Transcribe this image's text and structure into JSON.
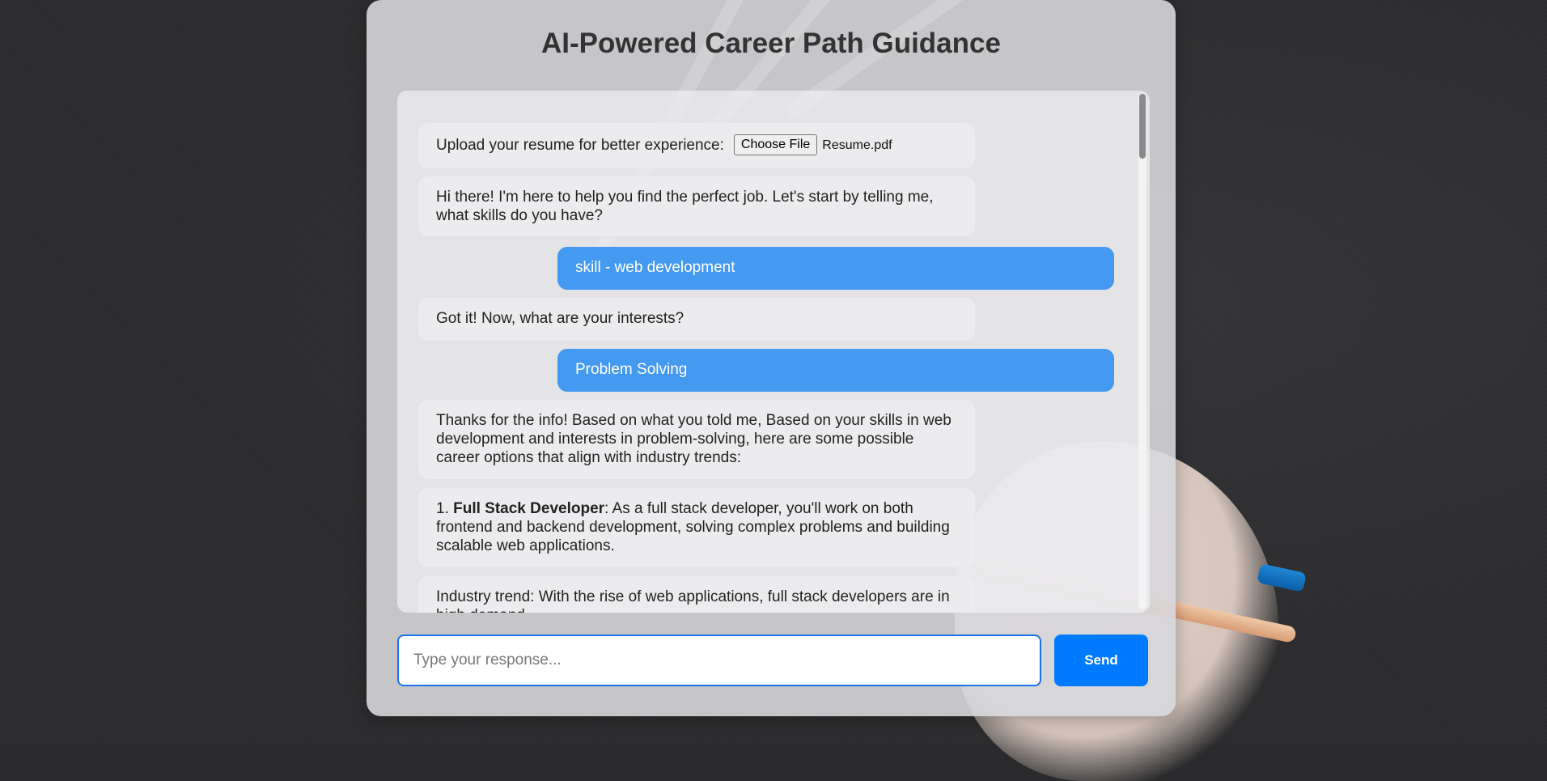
{
  "app": {
    "title": "AI-Powered Career Path Guidance"
  },
  "upload": {
    "label": "Upload your resume for better experience:",
    "button_label": "Choose File",
    "file_name": "Resume.pdf"
  },
  "messages": [
    {
      "sender": "bot",
      "text": "Hi there! I'm here to help you find the perfect job. Let's start by telling me, what skills do you have?"
    },
    {
      "sender": "user",
      "text": "skill - web development"
    },
    {
      "sender": "bot",
      "text": "Got it! Now, what are your interests?"
    },
    {
      "sender": "user",
      "text": "Problem Solving"
    },
    {
      "sender": "bot",
      "text": "Thanks for the info! Based on what you told me, Based on your skills in web development and interests in problem-solving, here are some possible career options that align with industry trends:"
    },
    {
      "sender": "bot",
      "prefix": "1. ",
      "bold": "Full Stack Developer",
      "text": ": As a full stack developer, you'll work on both frontend and backend development, solving complex problems and building scalable web applications."
    },
    {
      "sender": "bot",
      "text": "Industry trend: With the rise of web applications, full stack developers are in high demand."
    }
  ],
  "composer": {
    "placeholder": "Type your response...",
    "value": "",
    "send_label": "Send"
  },
  "colors": {
    "accent": "#007bff",
    "user_bubble": "#4499f0",
    "input_border": "#1a73e8"
  }
}
